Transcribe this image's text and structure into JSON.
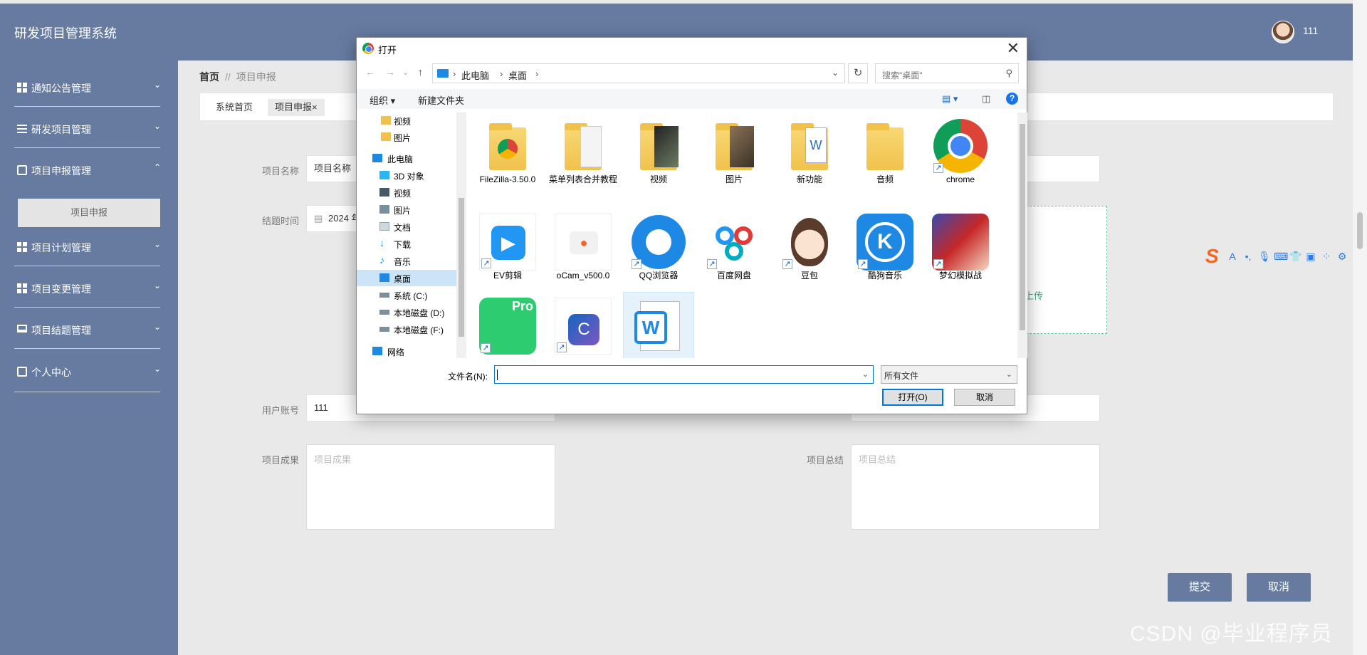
{
  "app": {
    "title": "研发项目管理系统",
    "user": "111"
  },
  "sidebar": {
    "items": [
      {
        "label": "通知公告管理",
        "icon": "grid-icon",
        "chevron": "⌄"
      },
      {
        "label": "研发项目管理",
        "icon": "sliders-icon",
        "chevron": "⌄"
      },
      {
        "label": "项目申报管理",
        "icon": "clipboard-icon",
        "chevron": "⌃"
      },
      {
        "label": "项目计划管理",
        "icon": "grid-icon",
        "chevron": "⌄"
      },
      {
        "label": "项目变更管理",
        "icon": "grid-icon",
        "chevron": "⌄"
      },
      {
        "label": "项目结题管理",
        "icon": "monitor-icon",
        "chevron": "⌄"
      },
      {
        "label": "个人中心",
        "icon": "id-card-icon",
        "chevron": "⌄"
      }
    ],
    "sub_item": "项目申报"
  },
  "breadcrumb": {
    "home": "首页",
    "sep": "//",
    "current": "项目申报"
  },
  "tabs": [
    {
      "label": "系统首页"
    },
    {
      "label": "项目申报",
      "close": "×"
    }
  ],
  "form": {
    "project_name_label": "项目名称",
    "project_name_value": "项目名称",
    "close_time_label": "结题时间",
    "close_time_value": "2024 年",
    "account_label": "用户账号",
    "account_value": "111",
    "result_label": "项目成果",
    "result_placeholder": "项目成果",
    "summary_label": "项目总结",
    "summary_placeholder": "项目总结",
    "upload_text": "上传"
  },
  "buttons": {
    "submit": "提交",
    "cancel": "取消"
  },
  "watermark": "CSDN @毕业程序员",
  "ime": {
    "logo": "S",
    "glyphs": [
      "A",
      "•,",
      "🎙",
      "⌨",
      "👕",
      "▣",
      "⁘",
      "⚙"
    ]
  },
  "dialog": {
    "title": "打开",
    "close": "✕",
    "nav": {
      "back": "←",
      "forward": "→",
      "recent": "⌄",
      "up": "↑"
    },
    "address": [
      "此电脑",
      "桌面"
    ],
    "address_sep": "›",
    "refresh": "↻",
    "search_placeholder": "搜索\"桌面\"",
    "toolbar": {
      "organize": "组织 ▾",
      "new_folder": "新建文件夹",
      "help": "?"
    },
    "nav_pane": [
      {
        "label": "视频",
        "icon": "folder-icon",
        "indent": 1
      },
      {
        "label": "图片",
        "icon": "folder-icon",
        "indent": 1
      },
      {
        "label": "此电脑",
        "icon": "computer-icon",
        "indent": 0
      },
      {
        "label": "3D 对象",
        "icon": "cube-icon",
        "indent": 1
      },
      {
        "label": "视频",
        "icon": "video-icon",
        "indent": 1
      },
      {
        "label": "图片",
        "icon": "picture-icon",
        "indent": 1
      },
      {
        "label": "文档",
        "icon": "document-icon",
        "indent": 1
      },
      {
        "label": "下载",
        "icon": "download-icon",
        "indent": 1
      },
      {
        "label": "音乐",
        "icon": "music-icon",
        "indent": 1
      },
      {
        "label": "桌面",
        "icon": "desktop-icon",
        "indent": 1,
        "selected": true
      },
      {
        "label": "系统 (C:)",
        "icon": "drive-icon",
        "indent": 1
      },
      {
        "label": "本地磁盘 (D:)",
        "icon": "drive-icon",
        "indent": 1
      },
      {
        "label": "本地磁盘 (F:)",
        "icon": "drive-icon",
        "indent": 1
      },
      {
        "label": "网络",
        "icon": "network-icon",
        "indent": 0
      }
    ],
    "files": [
      {
        "label": "FileZilla-3.50.0",
        "icon": "folder-chrome-icon"
      },
      {
        "label": "菜单列表合并教程",
        "icon": "folder-doc-icon"
      },
      {
        "label": "视频",
        "icon": "folder-video-icon"
      },
      {
        "label": "图片",
        "icon": "folder-picture-icon"
      },
      {
        "label": "新功能",
        "icon": "folder-word-icon"
      },
      {
        "label": "音频",
        "icon": "folder-audio-icon"
      },
      {
        "label": "chrome",
        "icon": "chrome-icon"
      },
      {
        "label": "EV剪辑",
        "icon": "ev-edit-icon"
      },
      {
        "label": "oCam_v500.0",
        "icon": "ocam-icon"
      },
      {
        "label": "QQ浏览器",
        "icon": "qq-browser-icon"
      },
      {
        "label": "百度网盘",
        "icon": "baidu-netdisk-icon"
      },
      {
        "label": "豆包",
        "icon": "doubao-icon"
      },
      {
        "label": "酷狗音乐",
        "icon": "kugou-icon"
      },
      {
        "label": "梦幻模拟战",
        "icon": "game-icon"
      },
      {
        "label": "",
        "icon": "cleaner-pro-icon",
        "badge": "Pro"
      },
      {
        "label": "",
        "icon": "c-app-icon"
      },
      {
        "label": "",
        "icon": "wps-word-icon"
      }
    ],
    "filename_label": "文件名(N):",
    "filename_value": "",
    "filetype": "所有文件",
    "open_button": "打开(O)",
    "cancel_button": "取消"
  }
}
